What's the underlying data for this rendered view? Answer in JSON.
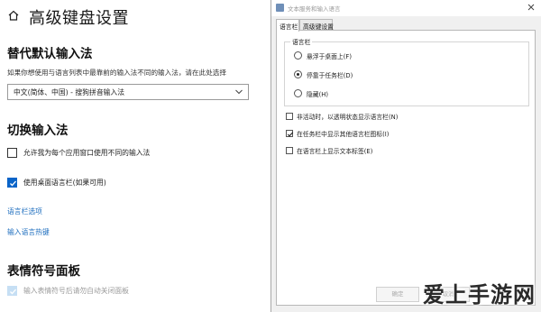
{
  "settings": {
    "title": "高级键盘设置",
    "override_section": {
      "title": "替代默认输入法",
      "description": "如果你想使用与语言列表中最靠前的输入法不同的输入法，请在此处选择",
      "dropdown_value": "中文(简体、中国) - 搜狗拼音输入法"
    },
    "switch_section": {
      "title": "切换输入法",
      "option_per_app": "允许我为每个应用窗口使用不同的输入法",
      "option_desktop_bar": "使用桌面语言栏(如果可用)",
      "link_bar_options": "语言栏选项",
      "link_hotkeys": "输入语言热键"
    },
    "emoji_section": {
      "title": "表情符号面板",
      "option_auto_close": "输入表情符号后请勿自动关闭面板"
    }
  },
  "dialog": {
    "title": "文本服务和输入语言",
    "tabs": [
      "语言栏",
      "高级键设置"
    ],
    "group_label": "语言栏",
    "radios": [
      "悬浮于桌面上(F)",
      "停靠于任务栏(D)",
      "隐藏(H)"
    ],
    "selected_radio": 1,
    "checkboxes": [
      {
        "label": "非活动时，以透明状态显示语言栏(N)",
        "checked": false
      },
      {
        "label": "在任务栏中显示其他语言栏图标(I)",
        "checked": true
      },
      {
        "label": "在语言栏上显示文本标签(E)",
        "checked": false
      }
    ],
    "ok_label": "确定",
    "cancel_label": "取消"
  },
  "watermark": "爱上手游网",
  "colors": {
    "accent": "#0a64c8",
    "link": "#1f6fbf"
  }
}
